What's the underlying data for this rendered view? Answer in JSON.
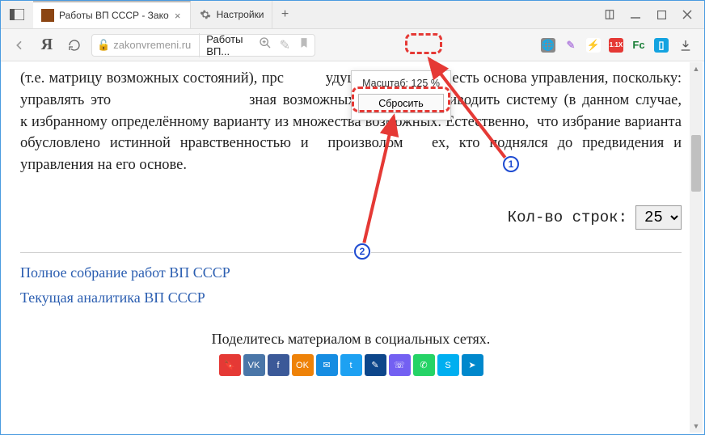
{
  "tabs": [
    {
      "title": "Работы ВП СССР - Зако",
      "active": true
    },
    {
      "title": "Настройки",
      "active": false
    }
  ],
  "address": {
    "domain": "zakonvremeni.ru",
    "page_title": "Работы ВП..."
  },
  "zoom": {
    "label": "Масштаб: 125 %",
    "reset": "Сбросить"
  },
  "body_text": "(т.е. матрицу возможных состояний), прс          удущее. Последнее есть основа управления, поскольку: управлять это                      зная возможных состояний приводить систему (в данном случае,                      к избранному определённому варианту из множества возможных. Естественно,  что избрание варианта обусловлено истинной нравственностью и  произволом   ех, кто поднялся до предвидения и управления на его основе.",
  "row_count": {
    "label": "Кол-во строк:",
    "value": "25"
  },
  "links": {
    "full": "Полное собрание работ ВП СССР",
    "current": "Текущая аналитика ВП СССР"
  },
  "share_label": "Поделитесь материалом в социальных сетях.",
  "share_buttons": [
    {
      "name": "bookmark",
      "bg": "#e53935",
      "g": "🔖"
    },
    {
      "name": "vk",
      "bg": "#4a76a8",
      "g": "VK"
    },
    {
      "name": "facebook",
      "bg": "#3b5998",
      "g": "f"
    },
    {
      "name": "ok",
      "bg": "#ee8208",
      "g": "OK"
    },
    {
      "name": "moimir",
      "bg": "#168de2",
      "g": "✉"
    },
    {
      "name": "twitter",
      "bg": "#1da1f2",
      "g": "t"
    },
    {
      "name": "lj",
      "bg": "#0d468a",
      "g": "✎"
    },
    {
      "name": "viber",
      "bg": "#7360f2",
      "g": "☏"
    },
    {
      "name": "whatsapp",
      "bg": "#25d366",
      "g": "✆"
    },
    {
      "name": "skype",
      "bg": "#00aff0",
      "g": "S"
    },
    {
      "name": "telegram",
      "bg": "#0088cc",
      "g": "➤"
    }
  ],
  "markers": {
    "one": "1",
    "two": "2"
  },
  "ext_icons": [
    {
      "name": "globe",
      "bg": "#888",
      "fg": "#fff",
      "g": "🌐"
    },
    {
      "name": "feather",
      "bg": "transparent",
      "fg": "#b98be0",
      "g": "✎"
    },
    {
      "name": "bolt",
      "bg": "#fff",
      "fg": "#e53935",
      "g": "⚡"
    },
    {
      "name": "stats",
      "bg": "#e53935",
      "fg": "#fff",
      "g": "1.1X"
    },
    {
      "name": "fc",
      "bg": "transparent",
      "fg": "#1a7f37",
      "g": "Fc"
    },
    {
      "name": "box",
      "bg": "#13a3e0",
      "fg": "#fff",
      "g": "▯"
    }
  ]
}
